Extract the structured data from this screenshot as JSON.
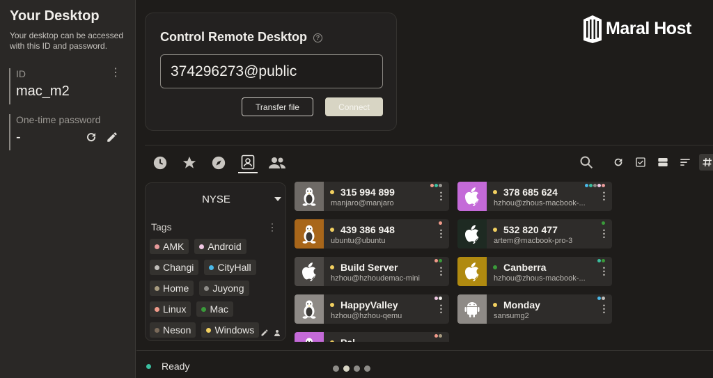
{
  "sidebar": {
    "title": "Your Desktop",
    "description": "Your desktop can be accessed with this ID and password.",
    "id_label": "ID",
    "id_value": "mac_m2",
    "otp_label": "One-time password",
    "otp_value": "-"
  },
  "remote": {
    "title": "Control Remote Desktop",
    "id_input_value": "374296273@public",
    "transfer_label": "Transfer file",
    "connect_label": "Connect"
  },
  "logo": {
    "text": "Maral Host"
  },
  "tabs": [
    {
      "icon": "history-icon"
    },
    {
      "icon": "star-icon"
    },
    {
      "icon": "compass-icon"
    },
    {
      "icon": "address-book-icon",
      "active": true
    },
    {
      "icon": "group-icon"
    }
  ],
  "toolbar_icons": [
    "search-icon",
    "refresh-icon",
    "checkbox-icon",
    "view-toggle-icon",
    "sort-icon",
    "hash-icon"
  ],
  "tag_panel": {
    "selected": "NYSE",
    "tags_header": "Tags",
    "tags": [
      {
        "name": "AMK",
        "color": "#e89a9a"
      },
      {
        "name": "Android",
        "color": "#f0c8e4"
      },
      {
        "name": "Changi",
        "color": "#c0beba"
      },
      {
        "name": "CityHall",
        "color": "#4ab8e8"
      },
      {
        "name": "Home",
        "color": "#a89c80"
      },
      {
        "name": "Juyong",
        "color": "#8e8c88"
      },
      {
        "name": "Linux",
        "color": "#f09a8a"
      },
      {
        "name": "Mac",
        "color": "#3a9a3a"
      },
      {
        "name": "Neson",
        "color": "#7a6a5a"
      },
      {
        "name": "Windows",
        "color": "#f2d060"
      }
    ]
  },
  "peers": [
    {
      "name": "315 994 899",
      "sub": "manjaro@manjaro",
      "os": "linux",
      "icon_bg": "#6e6a66",
      "status": "#f2d060",
      "tagdots": [
        "#f09a8a",
        "#3bbfa0",
        "#9a9792"
      ]
    },
    {
      "name": "378 685 624",
      "sub": "hzhou@zhous-macbook-...",
      "os": "mac",
      "icon_bg": "#c46ad8",
      "status": "#f2d060",
      "tagdots": [
        "#4ab8e8",
        "#3bbfa0",
        "#8e8c88",
        "#f0c8e4",
        "#e89a9a"
      ]
    },
    {
      "name": "439 386 948",
      "sub": "ubuntu@ubuntu",
      "os": "linux",
      "icon_bg": "#a8661a",
      "status": "#f2d060",
      "tagdots": [
        "#f09a8a"
      ]
    },
    {
      "name": "532 820 477",
      "sub": "artem@macbook-pro-3",
      "os": "mac",
      "icon_bg": "#1e2a22",
      "status": "#f2d060",
      "tagdots": [
        "#3a9a3a"
      ]
    },
    {
      "name": "Build Server",
      "sub": "hzhou@hzhoudemac-mini",
      "os": "mac",
      "icon_bg": "#4a4744",
      "status": "#f2d060",
      "tagdots": [
        "#f09a8a",
        "#3a9a3a"
      ]
    },
    {
      "name": "Canberra",
      "sub": "hzhou@zhous-macbook-...",
      "os": "mac",
      "icon_bg": "#b08a10",
      "status": "#3a9a3a",
      "tagdots": [
        "#3bbfa0",
        "#3a9a3a"
      ]
    },
    {
      "name": "HappyValley",
      "sub": "hzhou@hzhou-qemu",
      "os": "linux",
      "icon_bg": "#8e8a86",
      "status": "#f2d060",
      "tagdots": [
        "#f0c8e4",
        "#f0eeea"
      ]
    },
    {
      "name": "Monday",
      "sub": "sansumg2",
      "os": "android",
      "icon_bg": "#8e8a86",
      "status": "#f2d060",
      "tagdots": [
        "#4ab8e8",
        "#c0beba"
      ]
    },
    {
      "name": "Pal",
      "sub": "",
      "os": "linux",
      "icon_bg": "#c46ad8",
      "status": "#f2d060",
      "tagdots": [
        "#f09a8a",
        "#a89c80"
      ]
    }
  ],
  "status": {
    "text": "Ready",
    "pages": 4,
    "active_page": 2
  }
}
